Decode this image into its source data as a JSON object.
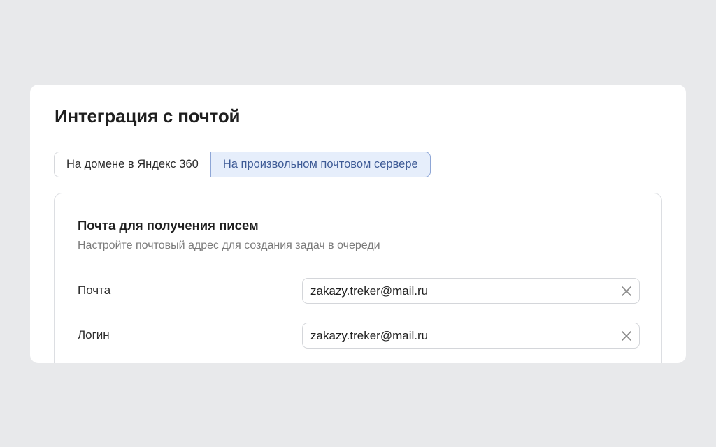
{
  "page": {
    "title": "Интеграция с почтой"
  },
  "tabs": [
    {
      "label": "На домене в Яндекс 360",
      "active": false
    },
    {
      "label": "На произвольном почтовом сервере",
      "active": true
    }
  ],
  "section": {
    "title": "Почта для получения писем",
    "subtitle": "Настройте почтовый адрес для создания задач в очереди",
    "fields": [
      {
        "label": "Почта",
        "value": "zakazy.treker@mail.ru",
        "icon": "close-icon"
      },
      {
        "label": "Логин",
        "value": "zakazy.treker@mail.ru",
        "icon": "close-icon"
      }
    ]
  },
  "colors": {
    "background": "#e8e9eb",
    "card": "#ffffff",
    "active_tab_bg": "#e6eefb",
    "active_tab_border": "#8ea6d6",
    "active_tab_text": "#3e5b96",
    "subtitle_text": "#7a7a7a"
  }
}
